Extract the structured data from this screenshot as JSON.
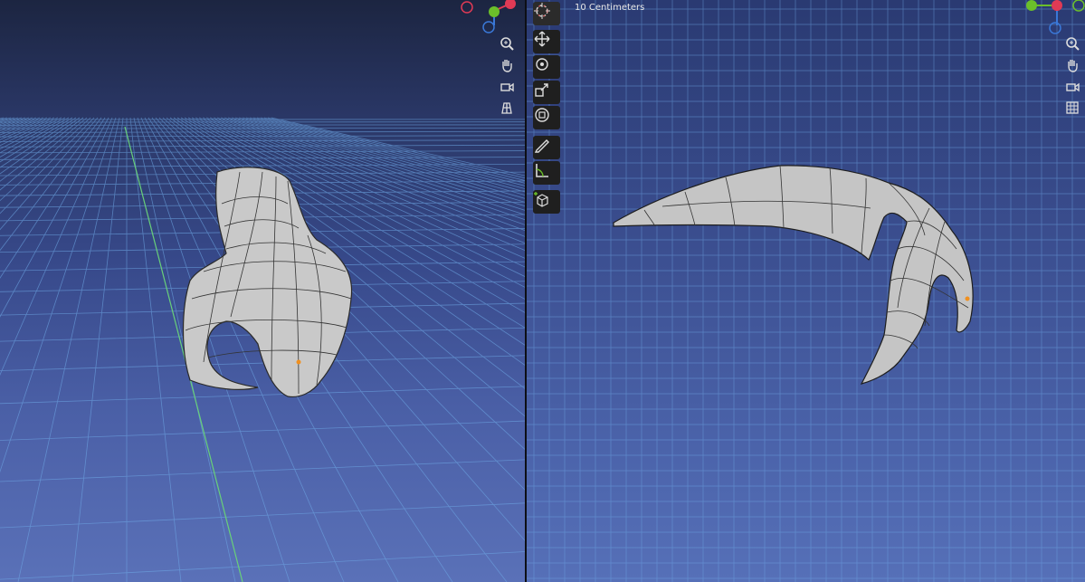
{
  "right_viewport": {
    "scale_label": "10 Centimeters"
  },
  "gizmo_left": {
    "axes": [
      "X",
      "Y",
      "Z"
    ]
  },
  "gizmo_right": {
    "axes": [
      "Y",
      "X"
    ]
  },
  "toolbar": {
    "tools": [
      "cursor-icon",
      "move-icon",
      "rotate-icon",
      "scale-icon",
      "transform-icon",
      "annotate-icon",
      "measure-icon",
      "add-cube-icon"
    ]
  },
  "nav_icons": [
    "zoom-icon",
    "pan-hand-icon",
    "camera-icon",
    "grid-icon"
  ],
  "colors": {
    "x_axis": "#e03a55",
    "y_axis": "#6bbf2a",
    "z_axis": "#3a78d8",
    "grid_line": "#6fa9e6",
    "mesh_fill": "#c8c8c8",
    "origin_dot": "#f09020"
  }
}
